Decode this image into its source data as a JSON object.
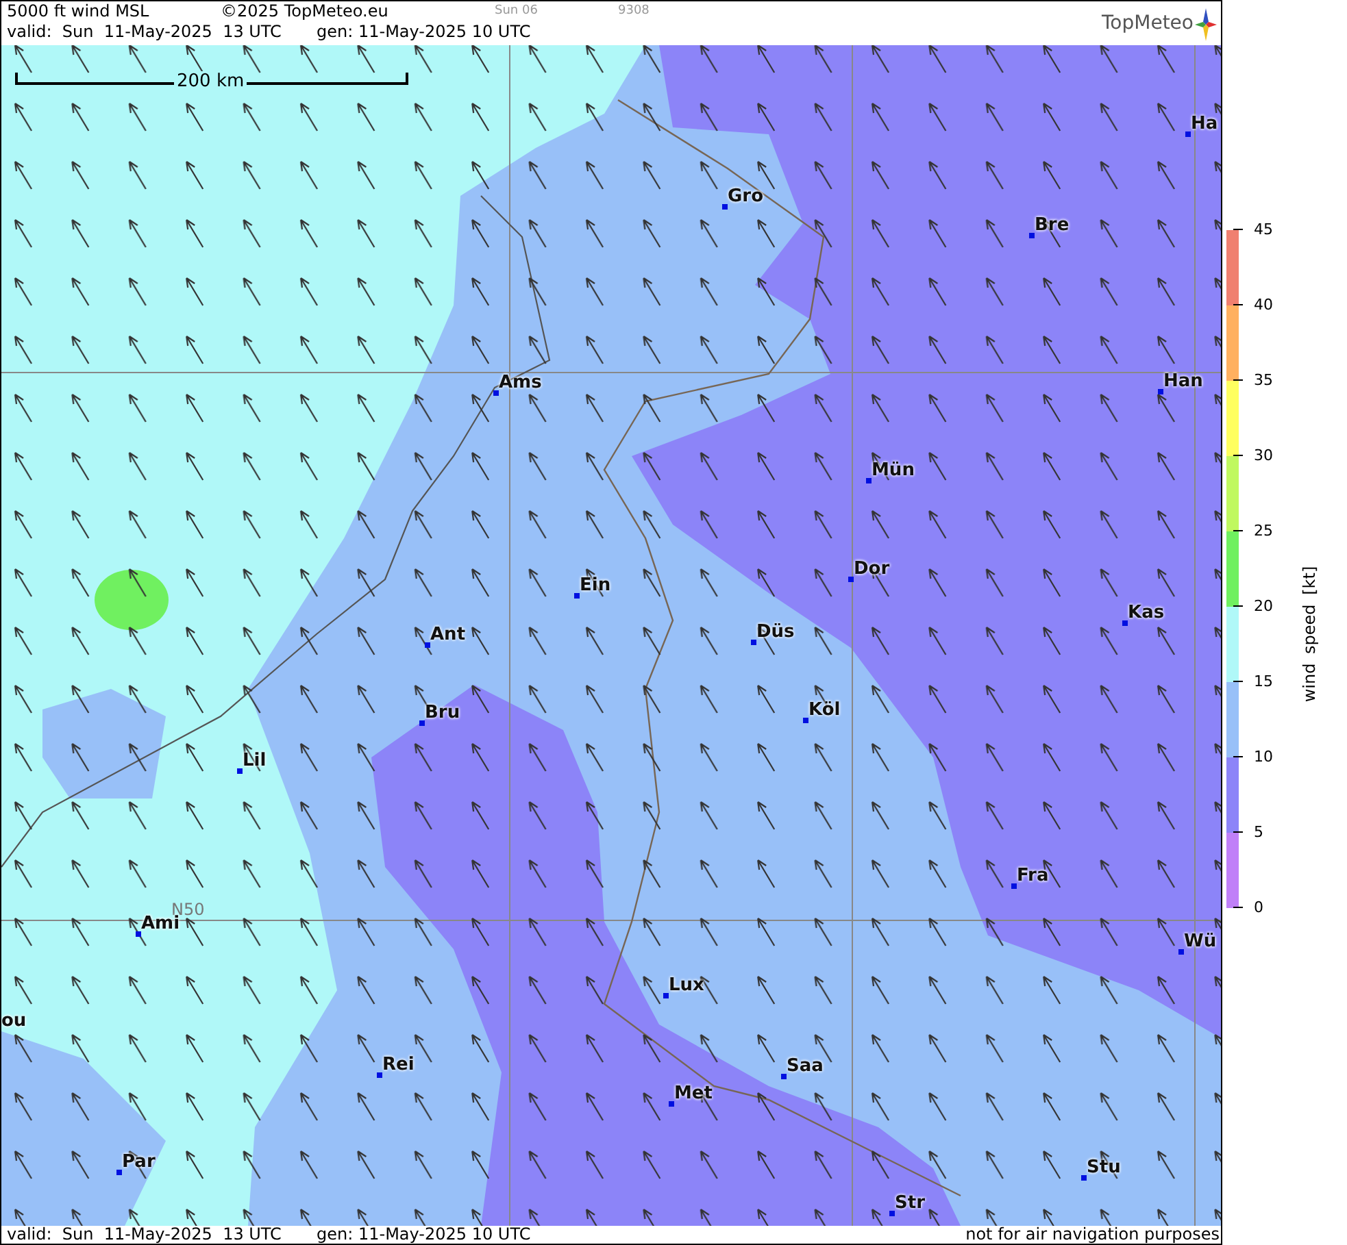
{
  "header": {
    "product": "5000 ft wind MSL",
    "copyright": "©2025 TopMeteo.eu",
    "day_code": "Sun 06",
    "run_code": "9308",
    "valid": "valid:  Sun  11-May-2025  13 UTC",
    "generated": "gen: 11-May-2025 10 UTC",
    "logo": "TopMeteo"
  },
  "map": {
    "scale": "200 km",
    "latitude_label": "N50",
    "cities": [
      {
        "name": "Ha"
      },
      {
        "name": "Gro"
      },
      {
        "name": "Bre"
      },
      {
        "name": "Ams"
      },
      {
        "name": "Han"
      },
      {
        "name": "Mün"
      },
      {
        "name": "Dor"
      },
      {
        "name": "Ein"
      },
      {
        "name": "Kas"
      },
      {
        "name": "Ant"
      },
      {
        "name": "Düs"
      },
      {
        "name": "Köl"
      },
      {
        "name": "Bru"
      },
      {
        "name": "Lil"
      },
      {
        "name": "Fra"
      },
      {
        "name": "Ami"
      },
      {
        "name": "Wü"
      },
      {
        "name": "Lux"
      },
      {
        "name": "ou"
      },
      {
        "name": "Rei"
      },
      {
        "name": "Saa"
      },
      {
        "name": "Met"
      },
      {
        "name": "Par"
      },
      {
        "name": "Stu"
      },
      {
        "name": "Str"
      }
    ]
  },
  "legend": {
    "title": "wind speed [kt]",
    "ticks": [
      "45",
      "40",
      "35",
      "30",
      "25",
      "20",
      "15",
      "10",
      "5",
      "0"
    ],
    "bins": [
      {
        "color": "#f08070"
      },
      {
        "color": "#ffb060"
      },
      {
        "color": "#ffff60"
      },
      {
        "color": "#c0f860"
      },
      {
        "color": "#70f060"
      },
      {
        "color": "#b0f8f8"
      },
      {
        "color": "#98c0f8"
      },
      {
        "color": "#8c84f8"
      },
      {
        "color": "#c080f8"
      }
    ]
  },
  "footer": {
    "valid": "valid:  Sun  11-May-2025  13 UTC",
    "generated": "gen: 11-May-2025 10 UTC",
    "disclaimer": "not for air navigation purposes"
  }
}
